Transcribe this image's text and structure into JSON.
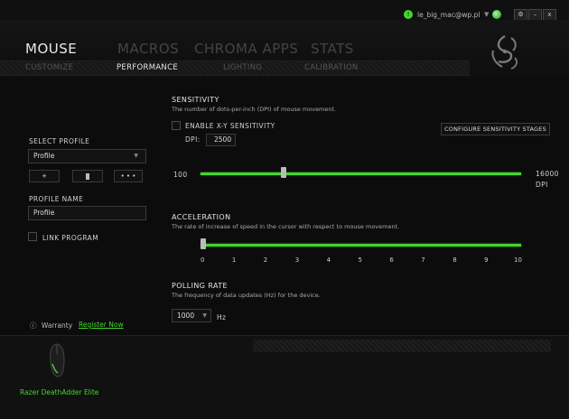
{
  "titlebar": {
    "user_badge": "!",
    "user": "le_big_mac@wp.pl",
    "caret": "▼",
    "settings_glyph": "⚙",
    "minimize_glyph": "–",
    "close_glyph": "x"
  },
  "nav": {
    "main": [
      "MOUSE",
      "MACROS",
      "CHROMA APPS",
      "STATS"
    ],
    "sub": [
      "CUSTOMIZE",
      "PERFORMANCE",
      "LIGHTING",
      "CALIBRATION"
    ]
  },
  "left": {
    "select_profile_label": "SELECT PROFILE",
    "profile_select_value": "Profile",
    "dropdown_caret": "▼",
    "add_glyph": "+",
    "more_glyph": "• • •",
    "profile_name_label": "PROFILE NAME",
    "profile_name_value": "Profile",
    "link_program_label": "LINK PROGRAM",
    "warranty_icon": "ⓘ",
    "warranty_label": "Warranty",
    "register_label": "Register Now"
  },
  "sensitivity": {
    "title": "SENSITIVITY",
    "description": "The number of dots-per-inch (DPI) of mouse movement.",
    "enable_xy_label": "ENABLE X-Y SENSITIVITY",
    "dpi_label": "DPI:",
    "dpi_value": "2500",
    "configure_label": "CONFIGURE SENSITIVITY STAGES",
    "min_label": "100",
    "max_label": "16000",
    "max_unit": "DPI",
    "value": 2500,
    "min": 100,
    "max": 16000
  },
  "acceleration": {
    "title": "ACCELERATION",
    "description": "The rate of increase of speed in the cursor with respect to mouse movement.",
    "ticks": [
      "0",
      "1",
      "2",
      "3",
      "4",
      "5",
      "6",
      "7",
      "8",
      "9",
      "10"
    ],
    "value": 0
  },
  "polling": {
    "title": "POLLING RATE",
    "description": "The frequency of data updates (Hz) for the device.",
    "value": "1000",
    "caret": "▼",
    "unit": "Hz"
  },
  "device": {
    "name": "Razer DeathAdder Elite"
  },
  "colors": {
    "accent": "#44d62c",
    "background": "#0c0c0c"
  }
}
